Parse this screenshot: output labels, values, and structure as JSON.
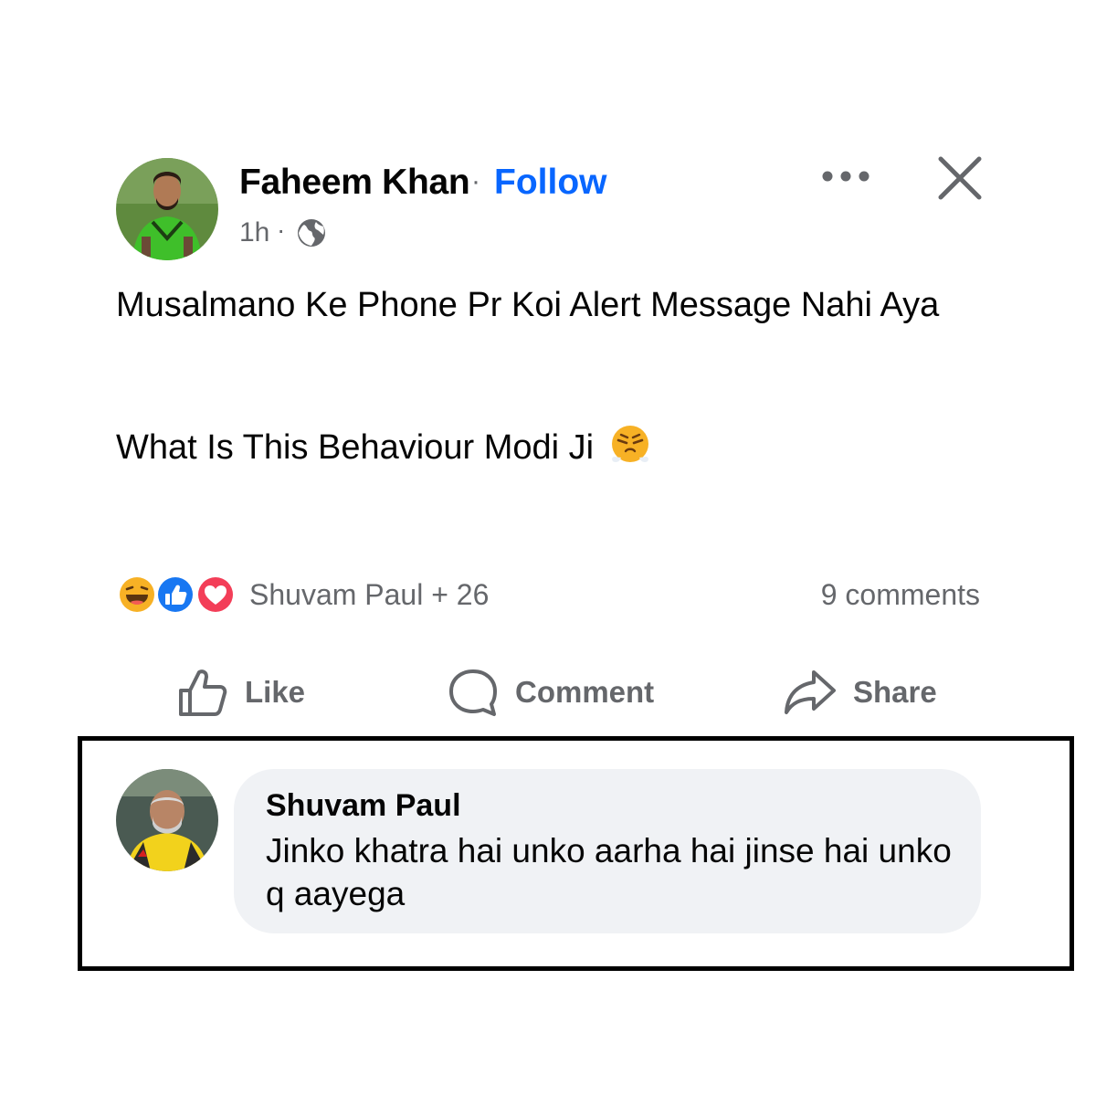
{
  "post": {
    "author": "Faheem Khan",
    "separator": "·",
    "follow_label": "Follow",
    "time": "1h",
    "meta_separator": "·",
    "privacy_icon": "globe-icon",
    "more_icon": "more-horizontal-icon",
    "close_icon": "close-icon",
    "text_line1": "Musalmano Ke Phone Pr Koi Alert Message Nahi Aya",
    "text_line2": "What Is This Behaviour Modi Ji",
    "text_emoji": "huffing-face-emoji"
  },
  "reactions": {
    "icons": [
      "haha-reaction-icon",
      "like-reaction-icon",
      "love-reaction-icon"
    ],
    "summary": "Shuvam Paul + 26",
    "comments_count": "9 comments"
  },
  "actions": {
    "like_label": "Like",
    "comment_label": "Comment",
    "share_label": "Share"
  },
  "comment": {
    "author": "Shuvam Paul",
    "text": "Jinko khatra hai unko aarha hai jinse hai unko q aayega"
  },
  "colors": {
    "follow_blue": "#0866ff",
    "meta_gray": "#65676b",
    "bubble_bg": "#f0f2f5",
    "like_blue": "#1877f2",
    "love_red": "#f33e58",
    "haha_yellow": "#f7b125"
  }
}
